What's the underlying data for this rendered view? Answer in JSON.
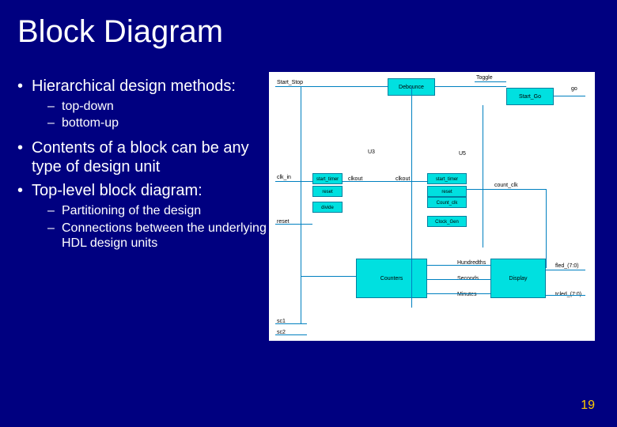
{
  "title": "Block Diagram",
  "bullets": {
    "b1": "Hierarchical design methods:",
    "b1a": "top-down",
    "b1b": "bottom-up",
    "b2": "Contents of a block can be any type of design unit",
    "b3": "Top-level block diagram:",
    "b3a": "Partitioning of the design",
    "b3b": "Connections between the underlying HDL design units"
  },
  "diagram": {
    "inputs": {
      "start_stop": "Start_Stop",
      "toggle": "Toggle",
      "clk_in": "clk_in",
      "reset": "reset",
      "sc1": "sc1",
      "sc2": "sc2"
    },
    "blocks": {
      "debounce": "Debounce",
      "start_go": "Start_Go",
      "u3_label": "U3",
      "u5_label": "U5",
      "start_timer": "start_timer",
      "reset_timer": "reset",
      "divide": "divide",
      "start": "start_timer",
      "reset2": "reset",
      "count_clk_blk": "Count_clk",
      "clock_gen": "Clock_Gen",
      "counters": "Counters",
      "display": "Display"
    },
    "signals": {
      "clkout": "clkout",
      "clkout2": "clkout",
      "countclk": "count_clk",
      "go": "go",
      "hundredths": "Hundredths",
      "seconds": "Seconds",
      "minutes": "Minutes",
      "fled": "fled_(7:0)",
      "tcled": "tcled_(7:0)"
    }
  },
  "page_number": "19"
}
